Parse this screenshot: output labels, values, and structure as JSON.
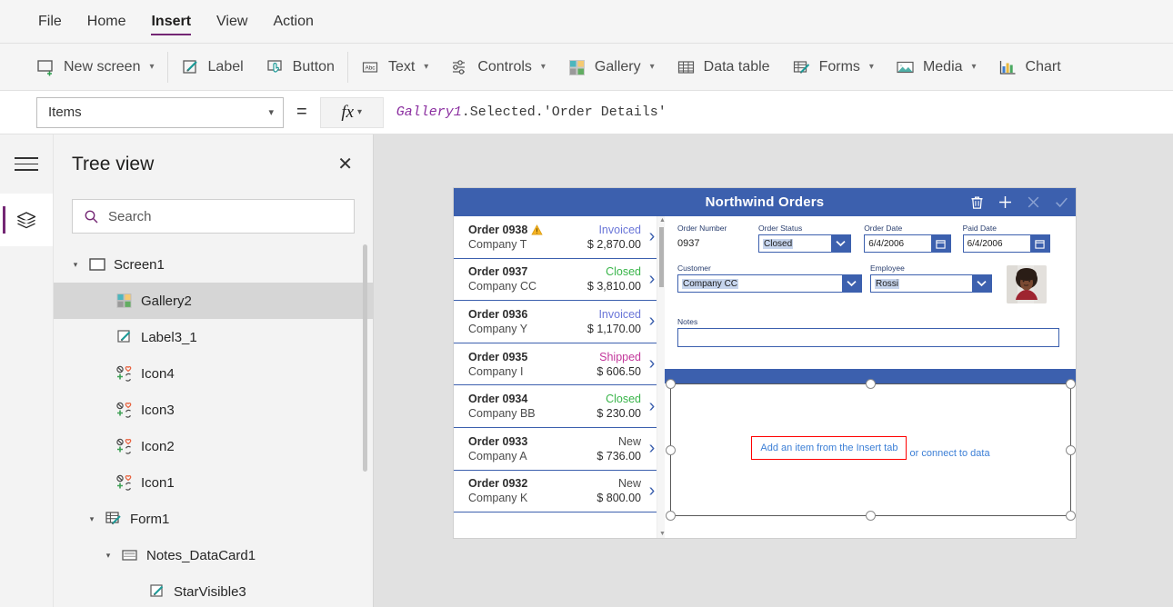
{
  "menu": {
    "items": [
      {
        "label": "File",
        "active": false
      },
      {
        "label": "Home",
        "active": false
      },
      {
        "label": "Insert",
        "active": true
      },
      {
        "label": "View",
        "active": false
      },
      {
        "label": "Action",
        "active": false
      }
    ]
  },
  "ribbon": {
    "groups": [
      {
        "items": [
          {
            "label": "New screen",
            "icon": "new-screen-icon",
            "caret": "⌄"
          }
        ]
      },
      {
        "items": [
          {
            "label": "Label",
            "icon": "label-icon",
            "caret": ""
          },
          {
            "label": "Button",
            "icon": "button-icon",
            "caret": ""
          }
        ]
      },
      {
        "items": [
          {
            "label": "Text",
            "icon": "text-abc-icon",
            "caret": "⌄"
          },
          {
            "label": "Controls",
            "icon": "controls-icon",
            "caret": "⌄"
          },
          {
            "label": "Gallery",
            "icon": "gallery-icon",
            "caret": "⌄"
          },
          {
            "label": "Data table",
            "icon": "data-table-icon",
            "caret": ""
          },
          {
            "label": "Forms",
            "icon": "forms-icon",
            "caret": "⌄"
          },
          {
            "label": "Media",
            "icon": "media-icon",
            "caret": "⌄"
          },
          {
            "label": "Chart",
            "icon": "chart-icon",
            "caret": ""
          }
        ]
      }
    ]
  },
  "formula_bar": {
    "property": "Items",
    "equals": "=",
    "fx": "fx",
    "formula_object": "Gallery1",
    "formula_rest": ".Selected.'Order Details'"
  },
  "rail": {
    "hamburger": "hamburger-icon",
    "active_tool": "tree-view-layers-icon"
  },
  "tree_panel": {
    "title": "Tree view",
    "close": "✕",
    "search": {
      "placeholder": "Search",
      "value": ""
    },
    "nodes": [
      {
        "label": "Screen1",
        "indent": 0,
        "twisty": "▾",
        "icon": "screen-icon",
        "selected": false
      },
      {
        "label": "Gallery2",
        "indent": 1,
        "twisty": "",
        "icon": "gallery-icon",
        "selected": true
      },
      {
        "label": "Label3_1",
        "indent": 1,
        "twisty": "",
        "icon": "label-icon",
        "selected": false
      },
      {
        "label": "Icon4",
        "indent": 1,
        "twisty": "",
        "icon": "icon-set-icon",
        "selected": false
      },
      {
        "label": "Icon3",
        "indent": 1,
        "twisty": "",
        "icon": "icon-set-icon",
        "selected": false
      },
      {
        "label": "Icon2",
        "indent": 1,
        "twisty": "",
        "icon": "icon-set-icon",
        "selected": false
      },
      {
        "label": "Icon1",
        "indent": 1,
        "twisty": "",
        "icon": "icon-set-icon",
        "selected": false
      },
      {
        "label": "Form1",
        "indent": 1,
        "twisty": "▾",
        "icon": "form-icon",
        "selected": false
      },
      {
        "label": "Notes_DataCard1",
        "indent": 2,
        "twisty": "▾",
        "icon": "datacard-icon",
        "selected": false
      },
      {
        "label": "StarVisible3",
        "indent": 3,
        "twisty": "",
        "icon": "label-icon",
        "selected": false
      }
    ]
  },
  "app_preview": {
    "header": {
      "title": "Northwind Orders",
      "icons": [
        {
          "name": "trash-icon",
          "enabled": true
        },
        {
          "name": "add-icon",
          "enabled": true
        },
        {
          "name": "cancel-x-icon",
          "enabled": false
        },
        {
          "name": "confirm-check-icon",
          "enabled": false
        }
      ]
    },
    "gallery": {
      "rows": [
        {
          "order": "Order 0938",
          "company": "Company T",
          "status": "Invoiced",
          "status_color": "#6a76d8",
          "amount": "$ 2,870.00",
          "warning": true
        },
        {
          "order": "Order 0937",
          "company": "Company CC",
          "status": "Closed",
          "status_color": "#3ab54a",
          "amount": "$ 3,810.00",
          "warning": false
        },
        {
          "order": "Order 0936",
          "company": "Company Y",
          "status": "Invoiced",
          "status_color": "#6a76d8",
          "amount": "$ 1,170.00",
          "warning": false
        },
        {
          "order": "Order 0935",
          "company": "Company I",
          "status": "Shipped",
          "status_color": "#c3379b",
          "amount": "$ 606.50",
          "warning": false
        },
        {
          "order": "Order 0934",
          "company": "Company BB",
          "status": "Closed",
          "status_color": "#3ab54a",
          "amount": "$ 230.00",
          "warning": false
        },
        {
          "order": "Order 0933",
          "company": "Company A",
          "status": "New",
          "status_color": "#4a4a4a",
          "amount": "$ 736.00",
          "warning": false
        },
        {
          "order": "Order 0932",
          "company": "Company K",
          "status": "New",
          "status_color": "#4a4a4a",
          "amount": "$ 800.00",
          "warning": false
        }
      ]
    },
    "form": {
      "order_number": {
        "label": "Order Number",
        "value": "0937"
      },
      "order_status": {
        "label": "Order Status",
        "value": "Closed"
      },
      "order_date": {
        "label": "Order Date",
        "value": "6/4/2006"
      },
      "paid_date": {
        "label": "Paid Date",
        "value": "6/4/2006"
      },
      "customer": {
        "label": "Customer",
        "value": "Company CC"
      },
      "employee": {
        "label": "Employee",
        "value": "Rossi"
      },
      "notes": {
        "label": "Notes",
        "value": ""
      },
      "employee_photo": "employee-avatar"
    },
    "selected_control": {
      "empty_text_boxed": "Add an item from the Insert tab",
      "empty_text_rest": " or connect to data"
    }
  },
  "colors": {
    "accent_purple": "#742774",
    "app_blue": "#3c60ae",
    "annotation_red": "#ff0000"
  }
}
